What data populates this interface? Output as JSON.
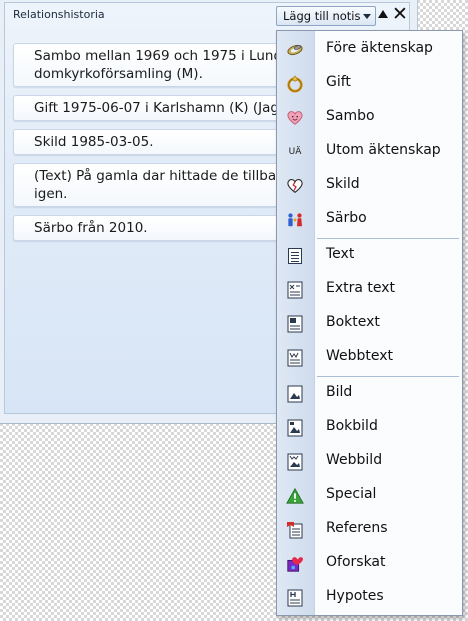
{
  "panel": {
    "title": "Relationshistoria"
  },
  "entries": [
    "Sambo mellan 1969 och 1975 i Lund\ndomkyrkoförsamling (M).",
    "Gift 1975-06-07 i Karlshamn (K) (Jag",
    "Skild 1985-03-05.",
    "(Text) På gamla dar hittade de tillba\nigen.",
    "Särbo från 2010."
  ],
  "toolbar": {
    "add_note_label": "Lägg till notis",
    "up_symbol": "▲",
    "close_symbol": "✕"
  },
  "menu": {
    "items": [
      {
        "label": "Före äktenskap",
        "icon": "rings-icon"
      },
      {
        "label": "Gift",
        "icon": "wedding-ring-icon"
      },
      {
        "label": "Sambo",
        "icon": "heart-face-icon"
      },
      {
        "label": "Utom äktenskap",
        "icon": "ua-icon",
        "icon_text": "UÄ"
      },
      {
        "label": "Skild",
        "icon": "broken-heart-icon"
      },
      {
        "label": "Särbo",
        "icon": "couple-icon"
      },
      {
        "label": "Text",
        "icon": "text-document-icon"
      },
      {
        "label": "Extra text",
        "icon": "extra-text-icon"
      },
      {
        "label": "Boktext",
        "icon": "book-text-icon"
      },
      {
        "label": "Webbtext",
        "icon": "web-text-icon"
      },
      {
        "label": "Bild",
        "icon": "picture-icon"
      },
      {
        "label": "Bokbild",
        "icon": "book-picture-icon"
      },
      {
        "label": "Webbild",
        "icon": "web-picture-icon"
      },
      {
        "label": "Special",
        "icon": "warning-triangle-icon"
      },
      {
        "label": "Referens",
        "icon": "reference-icon"
      },
      {
        "label": "Oforskat",
        "icon": "unresearched-icon"
      },
      {
        "label": "Hypotes",
        "icon": "hypothesis-icon"
      }
    ]
  },
  "colors": {
    "panel_gradient_top": "#eef4fb",
    "panel_gradient_bottom": "#d7e5f6",
    "menu_gutter": "#dfe8f4",
    "special_green": "#3aa33a",
    "heart_pink": "#f0a3b8"
  }
}
